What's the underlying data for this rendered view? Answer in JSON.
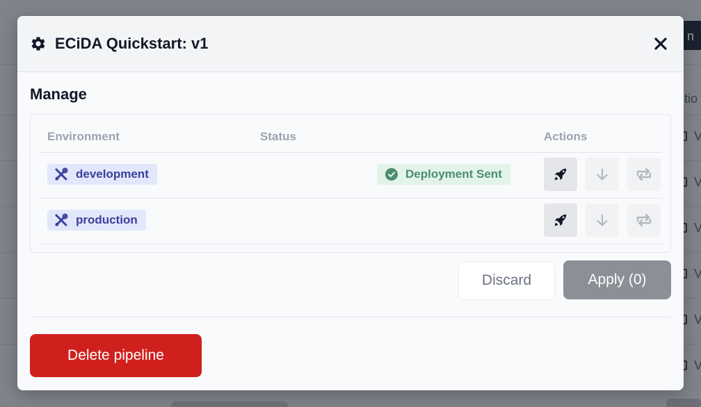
{
  "background": {
    "top_right_text": "y n",
    "side_header_text": "tio",
    "side_row_text": "V"
  },
  "modal": {
    "title": "ECiDA Quickstart: v1",
    "header_icon": "gear-icon",
    "close_icon": "close-icon",
    "section_title": "Manage",
    "table": {
      "columns": [
        "Environment",
        "Status",
        "Actions"
      ],
      "rows": [
        {
          "environment": "development",
          "status": "Deployment Sent",
          "actions": [
            "rocket-icon",
            "arrow-down-icon",
            "repeat-icon"
          ]
        },
        {
          "environment": "production",
          "status": "",
          "actions": [
            "rocket-icon",
            "arrow-down-icon",
            "repeat-icon"
          ]
        }
      ]
    },
    "buttons": {
      "discard": "Discard",
      "apply": "Apply (0)",
      "delete": "Delete pipeline"
    }
  },
  "colors": {
    "env_pill_bg": "#e3e7fb",
    "env_pill_text": "#3b3f9c",
    "status_bg": "#e2f3ea",
    "status_text": "#4d8e6c",
    "apply_bg": "#8b8f96",
    "delete_bg": "#d0201e"
  }
}
